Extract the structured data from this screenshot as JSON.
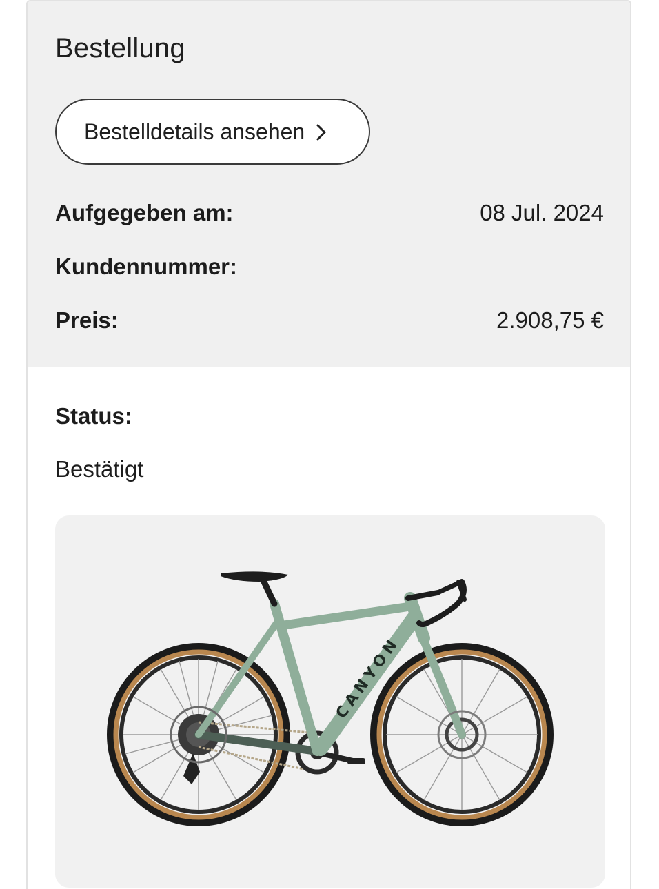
{
  "order": {
    "title": "Bestellung",
    "details_button_label": "Bestelldetails ansehen"
  },
  "info": {
    "placed_label": "Aufgegeben am:",
    "placed_value": "08 Jul. 2024",
    "customer_label": "Kundennummer:",
    "customer_value": "",
    "price_label": "Preis:",
    "price_value": "2.908,75 €"
  },
  "status": {
    "label": "Status:",
    "value": "Bestätigt"
  },
  "product": {
    "image_icon": "gravel-bike-image",
    "frame_text": "CANYON",
    "colors": {
      "frame": "#8fae9a",
      "tire_wall": "#b9874f",
      "tire": "#1b1b1b"
    }
  },
  "colors": {
    "top_panel_bg": "#f0f0f0",
    "button_border": "#3a3a3a",
    "text": "#1d1d1d"
  }
}
